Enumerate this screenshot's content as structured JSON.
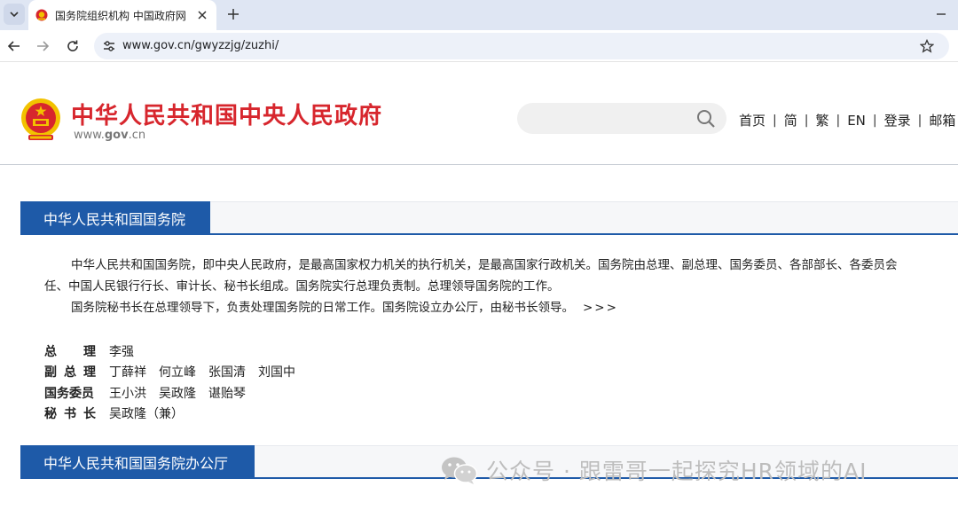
{
  "browser": {
    "tab_title": "国务院组织机构 中国政府网",
    "url": "www.gov.cn/gwyzzjg/zuzhi/"
  },
  "header": {
    "site_title": "中华人民共和国中央人民政府",
    "domain_prefix": "www.",
    "domain_name": "gov",
    "domain_suffix": ".cn",
    "search_placeholder": "",
    "links": [
      {
        "label": "首页"
      },
      {
        "label": "简"
      },
      {
        "label": "繁"
      },
      {
        "label": "EN"
      },
      {
        "label": "登录"
      },
      {
        "label": "邮箱"
      }
    ],
    "separator": "|"
  },
  "section_state_council": {
    "title": "中华人民共和国国务院",
    "intro_line1": "中华人民共和国国务院，即中央人民政府，是最高国家权力机关的执行机关，是最高国家行政机关。国务院由总理、副总理、国务委员、各部部长、各委员会",
    "intro_line2": "任、中国人民银行行长、审计长、秘书长组成。国务院实行总理负责制。总理领导国务院的工作。",
    "intro_line3": "国务院秘书长在总理领导下，负责处理国务院的日常工作。国务院设立办公厅，由秘书长领导。",
    "more_label": ">>>",
    "leaders": [
      {
        "title_chars": [
          "总",
          "理"
        ],
        "names": [
          "李强"
        ]
      },
      {
        "title_chars": [
          "副",
          "总",
          "理"
        ],
        "names": [
          "丁薛祥",
          "何立峰",
          "张国清",
          "刘国中"
        ]
      },
      {
        "title_chars": [
          "国务委员"
        ],
        "names": [
          "王小洪",
          "吴政隆",
          "谌贻琴"
        ]
      },
      {
        "title_chars": [
          "秘",
          "书",
          "长"
        ],
        "names": [
          "吴政隆（兼）"
        ]
      }
    ]
  },
  "section_general_office": {
    "title": "中华人民共和国国务院办公厅"
  },
  "watermark": {
    "text": "公众号 · 跟雷哥一起探究HR领域的AI"
  },
  "colors": {
    "brand_red": "#d7262d",
    "section_blue": "#1e5aa8",
    "emblem_gold": "#f2c200"
  }
}
